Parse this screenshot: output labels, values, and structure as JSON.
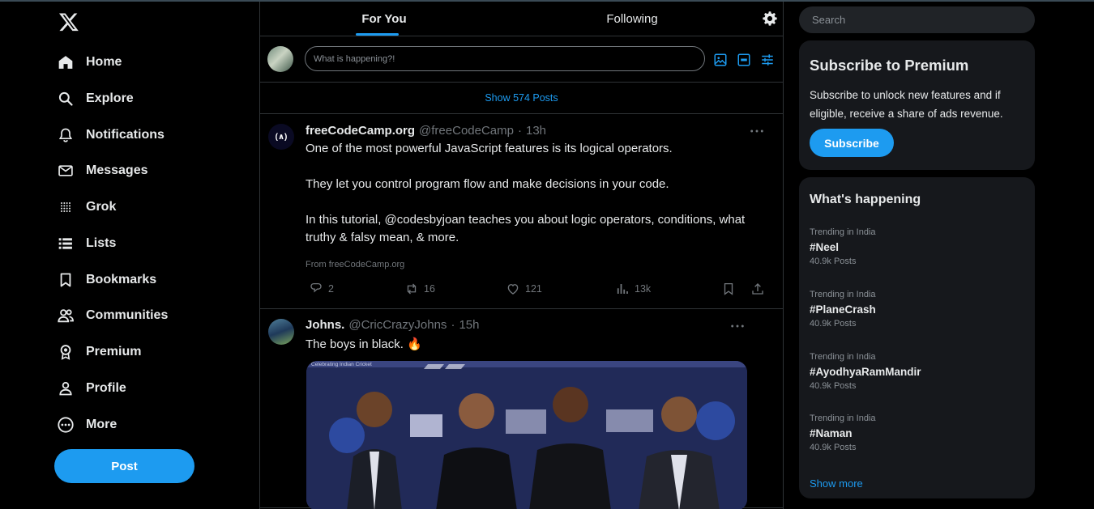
{
  "nav": {
    "items": [
      {
        "label": "Home",
        "icon": "home-icon"
      },
      {
        "label": "Explore",
        "icon": "search-icon"
      },
      {
        "label": "Notifications",
        "icon": "bell-icon"
      },
      {
        "label": "Messages",
        "icon": "envelope-icon"
      },
      {
        "label": "Grok",
        "icon": "grok-icon"
      },
      {
        "label": "Lists",
        "icon": "list-icon"
      },
      {
        "label": "Bookmarks",
        "icon": "bookmark-icon"
      },
      {
        "label": "Communities",
        "icon": "people-icon"
      },
      {
        "label": "Premium",
        "icon": "premium-icon"
      },
      {
        "label": "Profile",
        "icon": "person-icon"
      },
      {
        "label": "More",
        "icon": "more-circle-icon"
      }
    ],
    "post_label": "Post"
  },
  "tabs": {
    "for_you": "For You",
    "following": "Following"
  },
  "composer": {
    "placeholder": "What is happening?!"
  },
  "show_posts": "Show 574 Posts",
  "tweets": [
    {
      "name": "freeCodeCamp.org",
      "handle": "@freeCodeCamp",
      "dot": "·",
      "time": "13h",
      "avatar_text": "(∧)",
      "lines": [
        "One of the most powerful JavaScript features is its logical operators.",
        "They let you control program flow and make decisions in your code.",
        "In this tutorial, @codesbyjoan teaches you about logic operators, conditions, what truthy & falsy mean, & more."
      ],
      "source": "From freeCodeCamp.org",
      "replies": "2",
      "reposts": "16",
      "likes": "121",
      "views": "13k"
    },
    {
      "name": "Johns.",
      "handle": "@CricCrazyJohns",
      "dot": "·",
      "time": "15h",
      "text": "The boys in black. 🔥",
      "media_caption": "Celebrating Indian Cricket"
    }
  ],
  "search": {
    "placeholder": "Search"
  },
  "premium": {
    "title": "Subscribe to Premium",
    "body": "Subscribe to unlock new features and if eligible, receive a share of ads revenue.",
    "button": "Subscribe"
  },
  "trends": {
    "title": "What's happening",
    "items": [
      {
        "context": "Trending in India",
        "tag": "#Neel",
        "count": "40.9k Posts"
      },
      {
        "context": "Trending in India",
        "tag": "#PlaneCrash",
        "count": "40.9k Posts"
      },
      {
        "context": "Trending in India",
        "tag": "#AyodhyaRamMandir",
        "count": "40.9k Posts"
      },
      {
        "context": "Trending in India",
        "tag": "#Naman",
        "count": "40.9k Posts"
      }
    ],
    "show_more": "Show more"
  },
  "colors": {
    "accent": "#1d9bf0",
    "background": "#000000",
    "card": "#16181c",
    "muted": "#71767b"
  }
}
